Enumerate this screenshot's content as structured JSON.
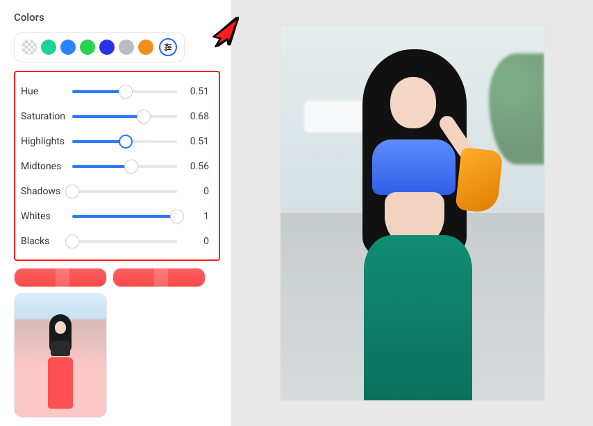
{
  "panel": {
    "title": "Colors"
  },
  "swatches": [
    {
      "id": "transparent",
      "color": "checker"
    },
    {
      "id": "teal",
      "color": "#20d29a"
    },
    {
      "id": "blue",
      "color": "#2a83ff"
    },
    {
      "id": "green",
      "color": "#28d24a"
    },
    {
      "id": "indigo",
      "color": "#2731e6"
    },
    {
      "id": "gray",
      "color": "#b9bcc0"
    },
    {
      "id": "orange",
      "color": "#f0901b"
    }
  ],
  "sliders": [
    {
      "key": "hue",
      "label": "Hue",
      "value": 0.51,
      "display": "0.51",
      "thumb": "default"
    },
    {
      "key": "saturation",
      "label": "Saturation",
      "value": 0.68,
      "display": "0.68",
      "thumb": "default"
    },
    {
      "key": "highlights",
      "label": "Highlights",
      "value": 0.51,
      "display": "0.51",
      "thumb": "solid"
    },
    {
      "key": "midtones",
      "label": "Midtones",
      "value": 0.56,
      "display": "0.56",
      "thumb": "default"
    },
    {
      "key": "shadows",
      "label": "Shadows",
      "value": 0,
      "display": "0",
      "thumb": "default"
    },
    {
      "key": "whites",
      "label": "Whites",
      "value": 1,
      "display": "1",
      "thumb": "default"
    },
    {
      "key": "blacks",
      "label": "Blacks",
      "value": 0,
      "display": "0",
      "thumb": "default"
    }
  ]
}
